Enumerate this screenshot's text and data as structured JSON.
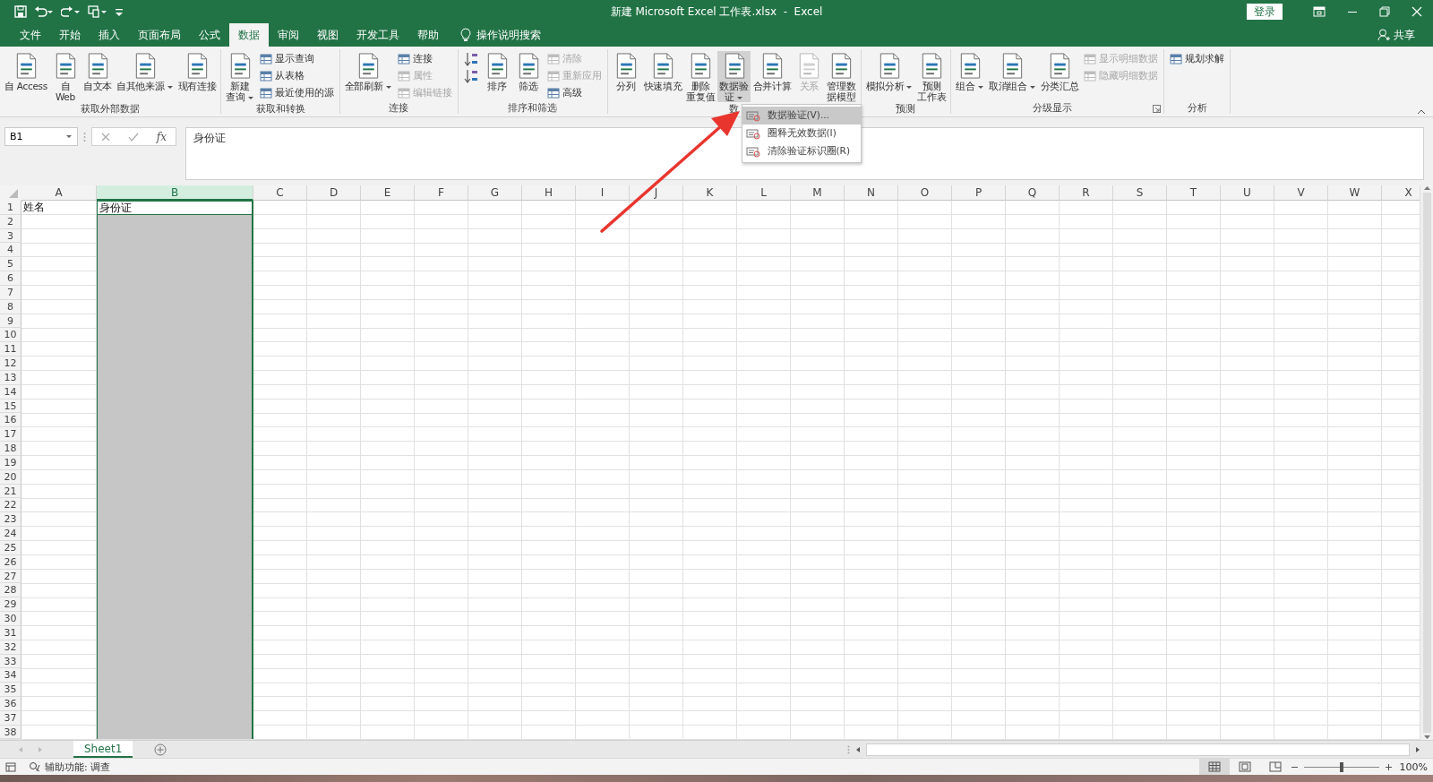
{
  "title_bar": {
    "title": "新建 Microsoft Excel 工作表.xlsx  -  Excel",
    "login_button": "登录"
  },
  "tabs": [
    {
      "label": "文件",
      "selected": false
    },
    {
      "label": "开始",
      "selected": false
    },
    {
      "label": "插入",
      "selected": false
    },
    {
      "label": "页面布局",
      "selected": false
    },
    {
      "label": "公式",
      "selected": false
    },
    {
      "label": "数据",
      "selected": true
    },
    {
      "label": "审阅",
      "selected": false
    },
    {
      "label": "视图",
      "selected": false
    },
    {
      "label": "开发工具",
      "selected": false
    },
    {
      "label": "帮助",
      "selected": false
    }
  ],
  "tell_me": "操作说明搜索",
  "share": "共享",
  "ribbon": {
    "groups": [
      {
        "label": "获取外部数据",
        "launcher": false,
        "items": [
          {
            "kind": "large",
            "lines": [
              "自 Access"
            ],
            "disabled": false,
            "pressed": false,
            "dropdown": false
          },
          {
            "kind": "large",
            "lines": [
              "自",
              "Web"
            ],
            "disabled": false,
            "pressed": false,
            "dropdown": false
          },
          {
            "kind": "large",
            "lines": [
              "自文本"
            ],
            "disabled": false,
            "pressed": false,
            "dropdown": false
          },
          {
            "kind": "large",
            "lines": [
              "自其他来源"
            ],
            "disabled": false,
            "pressed": false,
            "dropdown": true
          },
          {
            "kind": "large",
            "lines": [
              "现有连接"
            ],
            "disabled": false,
            "pressed": false,
            "dropdown": false
          }
        ]
      },
      {
        "label": "获取和转换",
        "launcher": false,
        "items": [
          {
            "kind": "large",
            "lines": [
              "新建",
              "查询"
            ],
            "disabled": false,
            "pressed": false,
            "dropdown": true
          },
          {
            "kind": "small",
            "label": "显示查询",
            "disabled": false,
            "pressed": false,
            "dropdown": false
          },
          {
            "kind": "small",
            "label": "从表格",
            "disabled": false,
            "pressed": false,
            "dropdown": false
          },
          {
            "kind": "small",
            "label": "最近使用的源",
            "disabled": false,
            "pressed": false,
            "dropdown": false
          }
        ]
      },
      {
        "label": "连接",
        "launcher": false,
        "items": [
          {
            "kind": "large",
            "lines": [
              "全部刷新"
            ],
            "disabled": false,
            "pressed": false,
            "dropdown": true
          },
          {
            "kind": "small",
            "label": "连接",
            "disabled": false,
            "pressed": false,
            "dropdown": false
          },
          {
            "kind": "small",
            "label": "属性",
            "disabled": true,
            "pressed": false,
            "dropdown": false
          },
          {
            "kind": "small",
            "label": "编辑链接",
            "disabled": true,
            "pressed": false,
            "dropdown": false
          }
        ]
      },
      {
        "label": "排序和筛选",
        "launcher": false,
        "items": [
          {
            "kind": "icon",
            "disabled": false,
            "pressed": false,
            "dropdown": false
          },
          {
            "kind": "icon",
            "disabled": false,
            "pressed": false,
            "dropdown": false
          },
          {
            "kind": "large",
            "lines": [
              "排序"
            ],
            "disabled": false,
            "pressed": false,
            "dropdown": false
          },
          {
            "kind": "large",
            "lines": [
              "筛选"
            ],
            "disabled": false,
            "pressed": false,
            "dropdown": false
          },
          {
            "kind": "small",
            "label": "清除",
            "disabled": true,
            "pressed": false,
            "dropdown": false
          },
          {
            "kind": "small",
            "label": "重新应用",
            "disabled": true,
            "pressed": false,
            "dropdown": false
          },
          {
            "kind": "small",
            "label": "高级",
            "disabled": false,
            "pressed": false,
            "dropdown": false
          }
        ]
      },
      {
        "label": "数",
        "launcher": false,
        "items": [
          {
            "kind": "large",
            "lines": [
              "分列"
            ],
            "disabled": false,
            "pressed": false,
            "dropdown": false
          },
          {
            "kind": "large",
            "lines": [
              "快速填充"
            ],
            "disabled": false,
            "pressed": false,
            "dropdown": false
          },
          {
            "kind": "large",
            "lines": [
              "删除",
              "重复值"
            ],
            "disabled": false,
            "pressed": false,
            "dropdown": false
          },
          {
            "kind": "large",
            "lines": [
              "数据验",
              "证"
            ],
            "disabled": false,
            "pressed": true,
            "dropdown": true
          },
          {
            "kind": "large",
            "lines": [
              "合并计算"
            ],
            "disabled": false,
            "pressed": false,
            "dropdown": false
          },
          {
            "kind": "large",
            "lines": [
              "关系"
            ],
            "disabled": true,
            "pressed": false,
            "dropdown": false
          },
          {
            "kind": "large",
            "lines": [
              "管理数",
              "据模型"
            ],
            "disabled": false,
            "pressed": false,
            "dropdown": false
          }
        ]
      },
      {
        "label": "预测",
        "launcher": false,
        "items": [
          {
            "kind": "large",
            "lines": [
              "模拟分析"
            ],
            "disabled": false,
            "pressed": false,
            "dropdown": true
          },
          {
            "kind": "large",
            "lines": [
              "预测",
              "工作表"
            ],
            "disabled": false,
            "pressed": false,
            "dropdown": false
          }
        ]
      },
      {
        "label": "分级显示",
        "launcher": true,
        "items": [
          {
            "kind": "large",
            "lines": [
              "组合"
            ],
            "disabled": false,
            "pressed": false,
            "dropdown": true
          },
          {
            "kind": "large",
            "lines": [
              "取消组合"
            ],
            "disabled": false,
            "pressed": false,
            "dropdown": true
          },
          {
            "kind": "large",
            "lines": [
              "分类汇总"
            ],
            "disabled": false,
            "pressed": false,
            "dropdown": false
          },
          {
            "kind": "small",
            "label": "显示明细数据",
            "disabled": true,
            "pressed": false,
            "dropdown": false
          },
          {
            "kind": "small",
            "label": "隐藏明细数据",
            "disabled": true,
            "pressed": false,
            "dropdown": false
          }
        ]
      },
      {
        "label": "分析",
        "launcher": false,
        "items": [
          {
            "kind": "small",
            "label": "规划求解",
            "disabled": false,
            "pressed": false,
            "dropdown": false
          }
        ]
      }
    ]
  },
  "validation_menu": {
    "items": [
      {
        "label": "数据验证(V)...",
        "selected": true
      },
      {
        "label": "圈释无效数据(I)",
        "selected": false
      },
      {
        "label": "清除验证标识圈(R)",
        "selected": false
      }
    ]
  },
  "formula_bar": {
    "name_box": "B1",
    "function_button": "fx",
    "formula": "身份证"
  },
  "sheet": {
    "columns": [
      {
        "label": "A",
        "selected": false
      },
      {
        "label": "B",
        "selected": true
      },
      {
        "label": "C",
        "selected": false
      },
      {
        "label": "D",
        "selected": false
      },
      {
        "label": "E",
        "selected": false
      },
      {
        "label": "F",
        "selected": false
      },
      {
        "label": "G",
        "selected": false
      },
      {
        "label": "H",
        "selected": false
      },
      {
        "label": "I",
        "selected": false
      },
      {
        "label": "J",
        "selected": false
      },
      {
        "label": "K",
        "selected": false
      },
      {
        "label": "L",
        "selected": false
      },
      {
        "label": "M",
        "selected": false
      },
      {
        "label": "N",
        "selected": false
      },
      {
        "label": "O",
        "selected": false
      },
      {
        "label": "P",
        "selected": false
      },
      {
        "label": "Q",
        "selected": false
      },
      {
        "label": "R",
        "selected": false
      },
      {
        "label": "S",
        "selected": false
      },
      {
        "label": "T",
        "selected": false
      },
      {
        "label": "U",
        "selected": false
      },
      {
        "label": "V",
        "selected": false
      },
      {
        "label": "W",
        "selected": false
      },
      {
        "label": "X",
        "selected": false
      }
    ],
    "rows": [
      {
        "number": "1",
        "cells": [
          "姓名",
          "身份证"
        ]
      },
      {
        "number": "2"
      },
      {
        "number": "3"
      },
      {
        "number": "4"
      },
      {
        "number": "5"
      },
      {
        "number": "6"
      },
      {
        "number": "7"
      },
      {
        "number": "8"
      },
      {
        "number": "9"
      },
      {
        "number": "10"
      },
      {
        "number": "11"
      },
      {
        "number": "12"
      },
      {
        "number": "13"
      },
      {
        "number": "14"
      },
      {
        "number": "15"
      },
      {
        "number": "16"
      },
      {
        "number": "17"
      },
      {
        "number": "18"
      },
      {
        "number": "19"
      },
      {
        "number": "20"
      },
      {
        "number": "21"
      },
      {
        "number": "22"
      },
      {
        "number": "23"
      },
      {
        "number": "24"
      },
      {
        "number": "25"
      },
      {
        "number": "26"
      },
      {
        "number": "27"
      },
      {
        "number": "28"
      },
      {
        "number": "29"
      },
      {
        "number": "30"
      },
      {
        "number": "31"
      },
      {
        "number": "32"
      },
      {
        "number": "33"
      },
      {
        "number": "34"
      },
      {
        "number": "35"
      },
      {
        "number": "36"
      },
      {
        "number": "37"
      },
      {
        "number": "38"
      }
    ]
  },
  "sheet_tabs": [
    {
      "label": "Sheet1",
      "selected": true
    }
  ],
  "status_bar": {
    "accessibility": "辅助功能: 调查",
    "views": [
      {
        "kind": "normal",
        "selected": true
      },
      {
        "kind": "page_layout",
        "selected": false
      },
      {
        "kind": "page_break",
        "selected": false
      }
    ],
    "zoom_slider": {
      "level": 0.5
    },
    "zoom": "100%"
  }
}
